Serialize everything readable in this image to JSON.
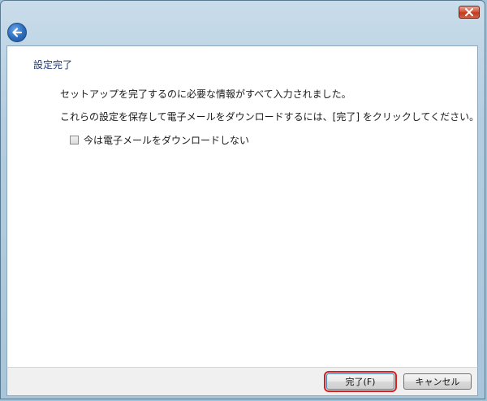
{
  "dialog": {
    "page_title": "設定完了",
    "message_1": "セットアップを完了するのに必要な情報がすべて入力されました。",
    "message_2": "これらの設定を保存して電子メールをダウンロードするには、[完了] をクリックしてください。",
    "checkbox_label": "今は電子メールをダウンロードしない",
    "checkbox_checked": false
  },
  "footer": {
    "finish_label": "完了(F)",
    "cancel_label": "キャンセル"
  },
  "icons": {
    "close": "close-icon",
    "back": "back-arrow-icon"
  },
  "colors": {
    "title_text": "#1f3b73",
    "close_button": "#c03a1e",
    "back_button": "#2f6fc0",
    "highlight_outline": "#d81e1e"
  }
}
